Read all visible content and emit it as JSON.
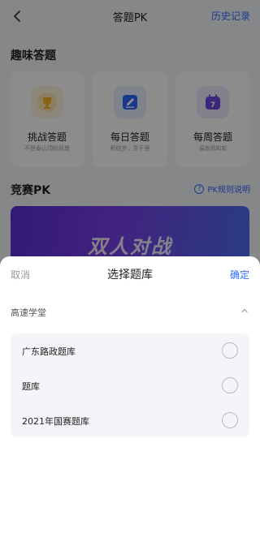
{
  "header": {
    "back_icon": "chevron-left-icon",
    "title": "答题PK",
    "history_label": "历史记录"
  },
  "fun_quiz": {
    "section_title": "趣味答题",
    "cards": [
      {
        "name": "挑战答题",
        "sub": "不登泰山顶的风景",
        "icon": "trophy-icon",
        "color": "#f5b52a"
      },
      {
        "name": "每日答题",
        "sub": "积硅步，至千里",
        "icon": "pencil-note-icon",
        "color": "#2f6bff"
      },
      {
        "name": "每周答题",
        "sub": "温故而知新",
        "icon": "calendar-icon",
        "color": "#6a4ce0"
      }
    ]
  },
  "contest": {
    "section_title": "竞赛PK",
    "rules_label": "PK规则说明",
    "banner_text": "双人对战"
  },
  "sheet": {
    "cancel_label": "取消",
    "title": "选择题库",
    "confirm_label": "确定",
    "group_label": "高速学堂",
    "options": [
      {
        "label": "广东路政题库",
        "selected": false
      },
      {
        "label": "题库",
        "selected": false
      },
      {
        "label": "2021年国赛题库",
        "selected": false
      }
    ]
  },
  "colors": {
    "accent": "#2f6bff",
    "overlay": "rgba(0,0,0,0.45)"
  }
}
